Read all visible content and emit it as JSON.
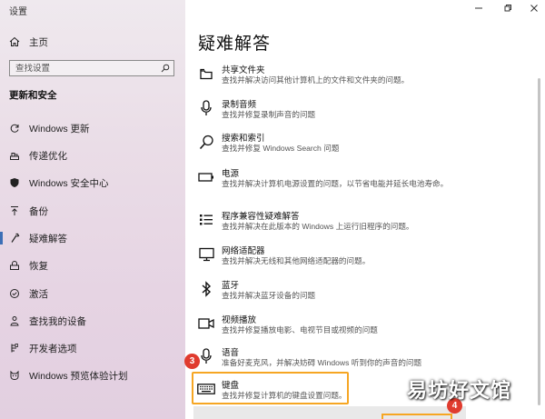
{
  "window": {
    "title": "设置",
    "minimize_glyph": "–",
    "maximize_glyph": "▫",
    "close_glyph": "✕"
  },
  "sidebar": {
    "home_label": "主页",
    "search_placeholder": "查找设置",
    "section_title": "更新和安全",
    "items": [
      {
        "label": "Windows 更新",
        "icon": "sync-icon"
      },
      {
        "label": "传递优化",
        "icon": "delivery-optimization-icon"
      },
      {
        "label": "Windows 安全中心",
        "icon": "shield-icon"
      },
      {
        "label": "备份",
        "icon": "backup-arrow-icon"
      },
      {
        "label": "疑难解答",
        "icon": "wrench-icon",
        "selected": true
      },
      {
        "label": "恢复",
        "icon": "recovery-icon"
      },
      {
        "label": "激活",
        "icon": "activation-check-icon"
      },
      {
        "label": "查找我的设备",
        "icon": "find-device-person-icon"
      },
      {
        "label": "开发者选项",
        "icon": "developer-options-icon"
      },
      {
        "label": "Windows 预览体验计划",
        "icon": "insider-cat-icon"
      }
    ]
  },
  "main": {
    "title": "疑难解答",
    "troubleshooters": [
      {
        "name": "共享文件夹",
        "desc": "查找并解决访问其他计算机上的文件和文件夹的问题。",
        "icon": "shared-folder-icon"
      },
      {
        "name": "录制音频",
        "desc": "查找并修复录制声音的问题",
        "icon": "microphone-icon"
      },
      {
        "name": "搜索和索引",
        "desc": "查找并修复 Windows Search 问题",
        "icon": "search-magnifier-icon"
      },
      {
        "name": "电源",
        "desc": "查找并解决计算机电源设置的问题，以节省电能并延长电池寿命。",
        "icon": "battery-icon"
      },
      {
        "name": "程序兼容性疑难解答",
        "desc": "查找并解决在此版本的 Windows 上运行旧程序的问题。",
        "icon": "program-list-icon"
      },
      {
        "name": "网络适配器",
        "desc": "查找并解决无线和其他网络适配器的问题。",
        "icon": "network-adapter-icon"
      },
      {
        "name": "蓝牙",
        "desc": "查找并解决蓝牙设备的问题",
        "icon": "bluetooth-icon"
      },
      {
        "name": "视频播放",
        "desc": "查找并修复播放电影、电视节目或视频的问题",
        "icon": "video-camera-icon"
      },
      {
        "name": "语音",
        "desc": "准备好麦克风，并解决妨碍 Windows 听到你的声音的问题",
        "icon": "speech-microphone-icon"
      },
      {
        "name": "键盘",
        "desc": "查找并修复计算机的键盘设置问题。",
        "icon": "keyboard-icon"
      }
    ]
  },
  "annotations": {
    "step3": "3",
    "step4": "4",
    "accent_color": "#f6a623",
    "badge_color": "#e03b2e"
  },
  "watermark": "易坊好文馆"
}
